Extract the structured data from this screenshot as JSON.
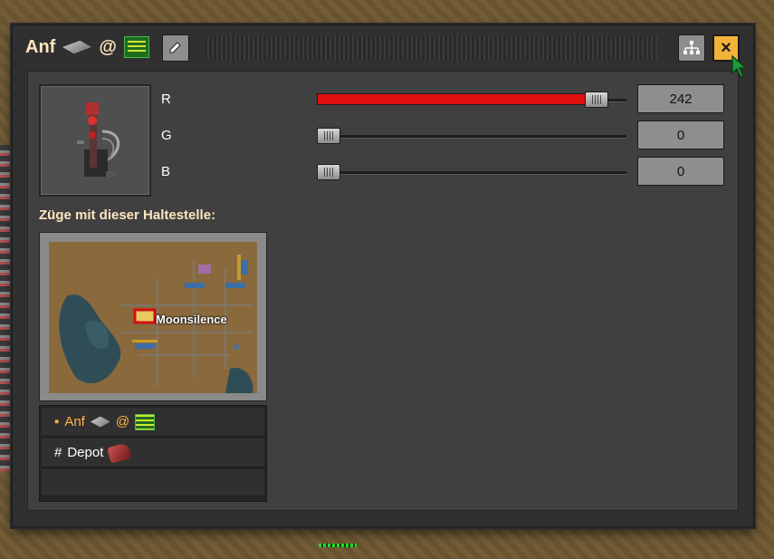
{
  "window": {
    "title": {
      "prefix": "Anf",
      "separator": "@",
      "icon_1": "rail-icon",
      "icon_2": "green-circuit-icon"
    },
    "buttons": {
      "rename": "pencil-icon",
      "network": "network-tree-icon",
      "close": "×"
    }
  },
  "color_picker": {
    "rows": [
      {
        "label": "R",
        "value": "242",
        "fraction": 0.949,
        "fill_color": "#e01010"
      },
      {
        "label": "G",
        "value": "0",
        "fraction": 0.0
      },
      {
        "label": "B",
        "value": "0",
        "fraction": 0.0
      }
    ]
  },
  "trains_section": {
    "heading": "Züge mit dieser Haltestelle:",
    "map_label": "Moonsilence"
  },
  "schedule": {
    "items": [
      {
        "bullet": "▪",
        "text": "Anf",
        "sep": "@",
        "state": "active"
      },
      {
        "bullet": "#",
        "text": "Depot",
        "state": "normal"
      }
    ]
  },
  "colors": {
    "accent": "#f2b23a",
    "heading": "#ffe6c0",
    "active_item": "#ffb441",
    "panel": "#414041"
  }
}
